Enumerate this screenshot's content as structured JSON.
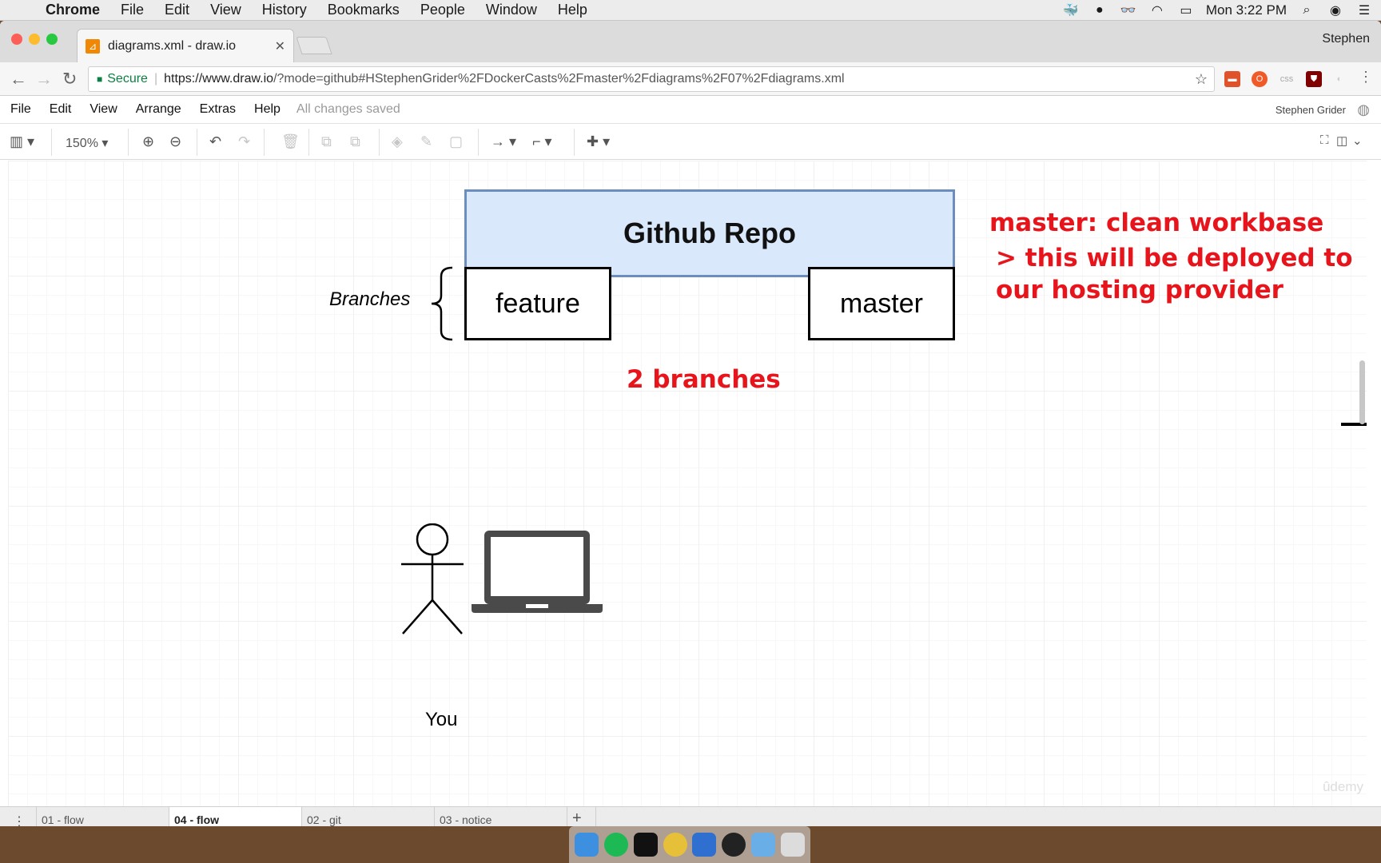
{
  "menubar": {
    "app": "Chrome",
    "items": [
      "File",
      "Edit",
      "View",
      "History",
      "Bookmarks",
      "People",
      "Window",
      "Help"
    ],
    "clock": "Mon 3:22 PM"
  },
  "browser": {
    "tab_title": "diagrams.xml - draw.io",
    "profile": "Stephen",
    "secure_label": "Secure",
    "url_host": "https://www.draw.io",
    "url_rest": "/?mode=github#HStephenGrider%2FDockerCasts%2Fmaster%2Fdiagrams%2F07%2Fdiagrams.xml"
  },
  "drawio": {
    "menu": [
      "File",
      "Edit",
      "View",
      "Arrange",
      "Extras",
      "Help"
    ],
    "save_status": "All changes saved",
    "user": "Stephen Grider",
    "zoom": "150%"
  },
  "diagram": {
    "repo_title": "Github Repo",
    "branches_label": "Branches",
    "branch_feature": "feature",
    "branch_master": "master",
    "note_line1": "master: clean workbase",
    "note_line2": "> this will be deployed to",
    "note_line3": "our hosting provider",
    "branch_count": "2 branches",
    "actor_label": "You",
    "watermark": "ûdemy"
  },
  "page_tabs": [
    "01 - flow",
    "04 - flow",
    "02 - git",
    "03 - notice"
  ],
  "colors": {
    "repo_fill": "#dae8fc",
    "repo_border": "#6c8ebf",
    "note_red": "#e8141c"
  }
}
